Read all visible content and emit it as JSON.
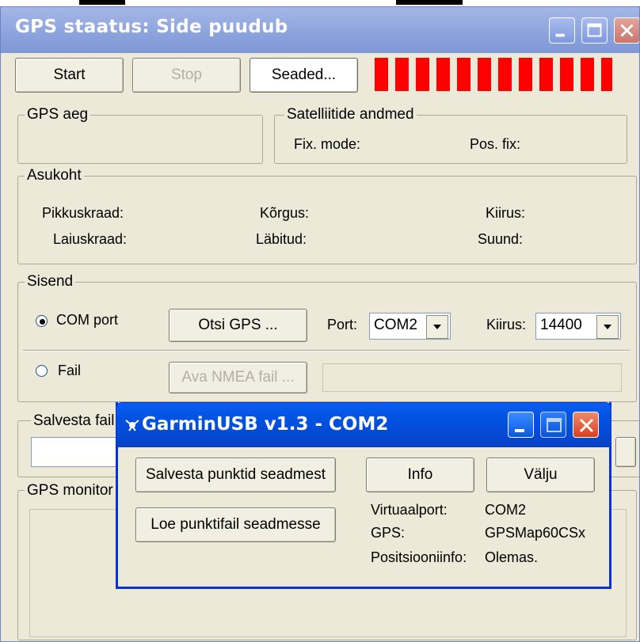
{
  "main": {
    "title": "GPS staatus: Side puudub",
    "buttons": {
      "start": "Start",
      "stop": "Stop",
      "settings": "Seaded..."
    },
    "signal_bar_count": 12,
    "gps_time": {
      "legend": "GPS aeg"
    },
    "satellite": {
      "legend": "Satelliitide andmed",
      "fix_mode": "Fix. mode:",
      "pos_fix": "Pos. fix:"
    },
    "location": {
      "legend": "Asukoht",
      "longitude": "Pikkuskraad:",
      "latitude": "Laiuskraad:",
      "altitude": "Kõrgus:",
      "distance": "Läbitud:",
      "speed": "Kiirus:",
      "direction": "Suund:"
    },
    "input": {
      "legend": "Sisend",
      "com_port": "COM port",
      "find_gps": "Otsi GPS ...",
      "port_label": "Port:",
      "port_value": "COM2",
      "speed_label": "Kiirus:",
      "speed_value": "14400",
      "file": "Fail",
      "open_nmea": "Ava NMEA fail ..."
    },
    "save_file": {
      "legend": "Salvesta fail"
    },
    "gps_monitor": {
      "legend": "GPS monitor"
    }
  },
  "dialog": {
    "title": "GarminUSB v1.3 - COM2",
    "buttons": {
      "save_points": "Salvesta punktid seadmest",
      "load_points": "Loe punktifail seadmesse",
      "info": "Info",
      "exit": "Välju"
    },
    "info": {
      "virtual_port_label": "Virtuaalport:",
      "virtual_port_value": "COM2",
      "gps_label": "GPS:",
      "gps_value": "GPSMap60CSx",
      "position_label": "Positsiooniinfo:",
      "position_value": "Olemas."
    }
  },
  "colors": {
    "signal": "#ff0000",
    "dialog_title": "#0a5ef0",
    "window_bg": "#ece9d8"
  }
}
